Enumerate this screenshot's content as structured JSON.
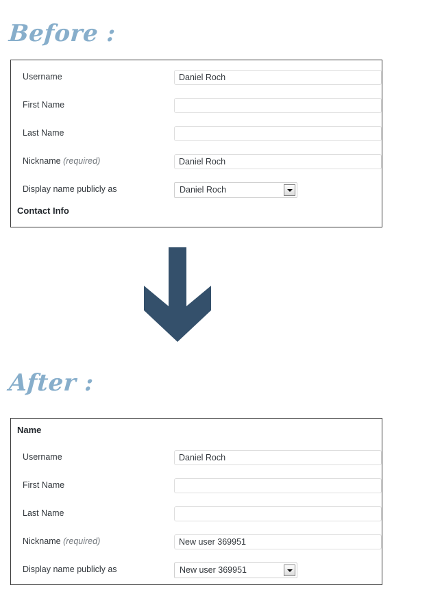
{
  "headings": {
    "before": "Before :",
    "after": "After :"
  },
  "arrow": {
    "name": "down-arrow",
    "color": "#34506b"
  },
  "accent_color": "#87aecb",
  "before_panel": {
    "fields": [
      {
        "label": "Username",
        "required_note": "",
        "type": "text",
        "value": "Daniel Roch"
      },
      {
        "label": "First Name",
        "required_note": "",
        "type": "text",
        "value": ""
      },
      {
        "label": "Last Name",
        "required_note": "",
        "type": "text",
        "value": ""
      },
      {
        "label": "Nickname",
        "required_note": "(required)",
        "type": "text",
        "value": "Daniel Roch"
      },
      {
        "label": "Display name publicly as",
        "required_note": "",
        "type": "select",
        "value": "Daniel Roch"
      }
    ],
    "footer_heading": "Contact Info"
  },
  "after_panel": {
    "section_heading": "Name",
    "fields": [
      {
        "label": "Username",
        "required_note": "",
        "type": "text",
        "value": "Daniel Roch"
      },
      {
        "label": "First Name",
        "required_note": "",
        "type": "text",
        "value": ""
      },
      {
        "label": "Last Name",
        "required_note": "",
        "type": "text",
        "value": ""
      },
      {
        "label": "Nickname",
        "required_note": "(required)",
        "type": "text",
        "value": "New user 369951"
      },
      {
        "label": "Display name publicly as",
        "required_note": "",
        "type": "select",
        "value": "New user 369951"
      }
    ]
  }
}
